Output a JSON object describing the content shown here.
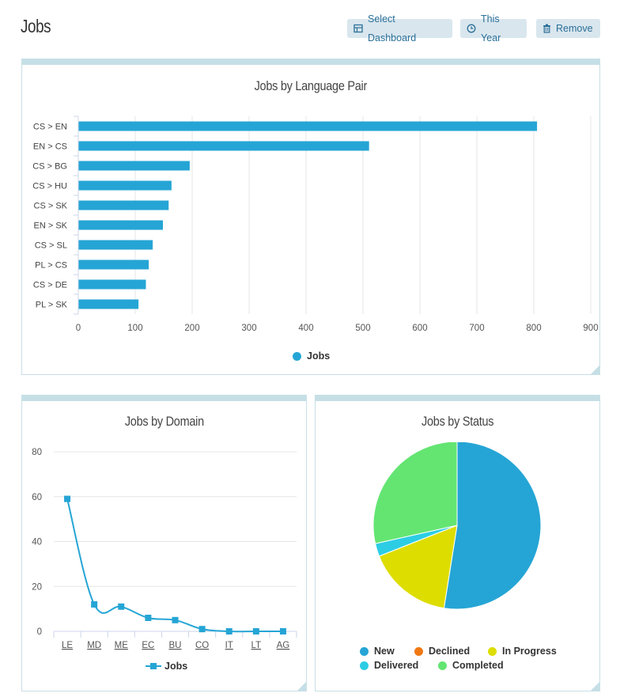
{
  "page": {
    "title": "Jobs"
  },
  "toolbar": {
    "select_dashboard_label": "Select Dashboard",
    "this_year_label": "This Year",
    "remove_label": "Remove"
  },
  "colors": {
    "accent": "#25a5d5",
    "button_bg": "#d9e6ee",
    "button_text": "#2a6f98",
    "panel_border": "#c6dfe6"
  },
  "icons": {
    "select_dashboard": "dashboard-icon",
    "this_year": "clock-icon",
    "remove": "trash-icon"
  },
  "panels": {
    "language_pair": {
      "title": "Jobs by Language Pair",
      "legend": "Jobs"
    },
    "domain": {
      "title": "Jobs by Domain",
      "legend": "Jobs"
    },
    "status": {
      "title": "Jobs by Status"
    }
  },
  "chart_data": [
    {
      "type": "bar",
      "orientation": "horizontal",
      "title": "Jobs by Language Pair",
      "categories": [
        "CS > EN",
        "EN > CS",
        "CS > BG",
        "CS > HU",
        "CS > SK",
        "EN > SK",
        "CS > SL",
        "PL > CS",
        "CS > DE",
        "PL > SK"
      ],
      "series": [
        {
          "name": "Jobs",
          "values": [
            805,
            510,
            195,
            163,
            158,
            148,
            130,
            123,
            118,
            105
          ],
          "color": "#25a5d5"
        }
      ],
      "xlim": [
        0,
        900
      ],
      "xticks": [
        0,
        100,
        200,
        300,
        400,
        500,
        600,
        700,
        800,
        900
      ],
      "grid": true,
      "legend": "bottom-center"
    },
    {
      "type": "line",
      "title": "Jobs by Domain",
      "categories": [
        "LE",
        "MD",
        "ME",
        "EC",
        "BU",
        "CO",
        "IT",
        "LT",
        "AG"
      ],
      "series": [
        {
          "name": "Jobs",
          "values": [
            59,
            12,
            11,
            6,
            5,
            1,
            0,
            0,
            0
          ],
          "color": "#25a5d5",
          "marker": "square"
        }
      ],
      "ylim": [
        0,
        80
      ],
      "yticks": [
        0,
        20,
        40,
        60,
        80
      ],
      "grid": true,
      "legend": "bottom-center"
    },
    {
      "type": "pie",
      "title": "Jobs by Status",
      "slices": [
        {
          "name": "New",
          "value": 52.5,
          "color": "#25a5d5"
        },
        {
          "name": "Declined",
          "value": 0,
          "color": "#f07814"
        },
        {
          "name": "In Progress",
          "value": 16.5,
          "color": "#dddd00"
        },
        {
          "name": "Delivered",
          "value": 2.5,
          "color": "#2ccde4"
        },
        {
          "name": "Completed",
          "value": 28.5,
          "color": "#64e572"
        }
      ],
      "legend": "bottom-center"
    }
  ]
}
